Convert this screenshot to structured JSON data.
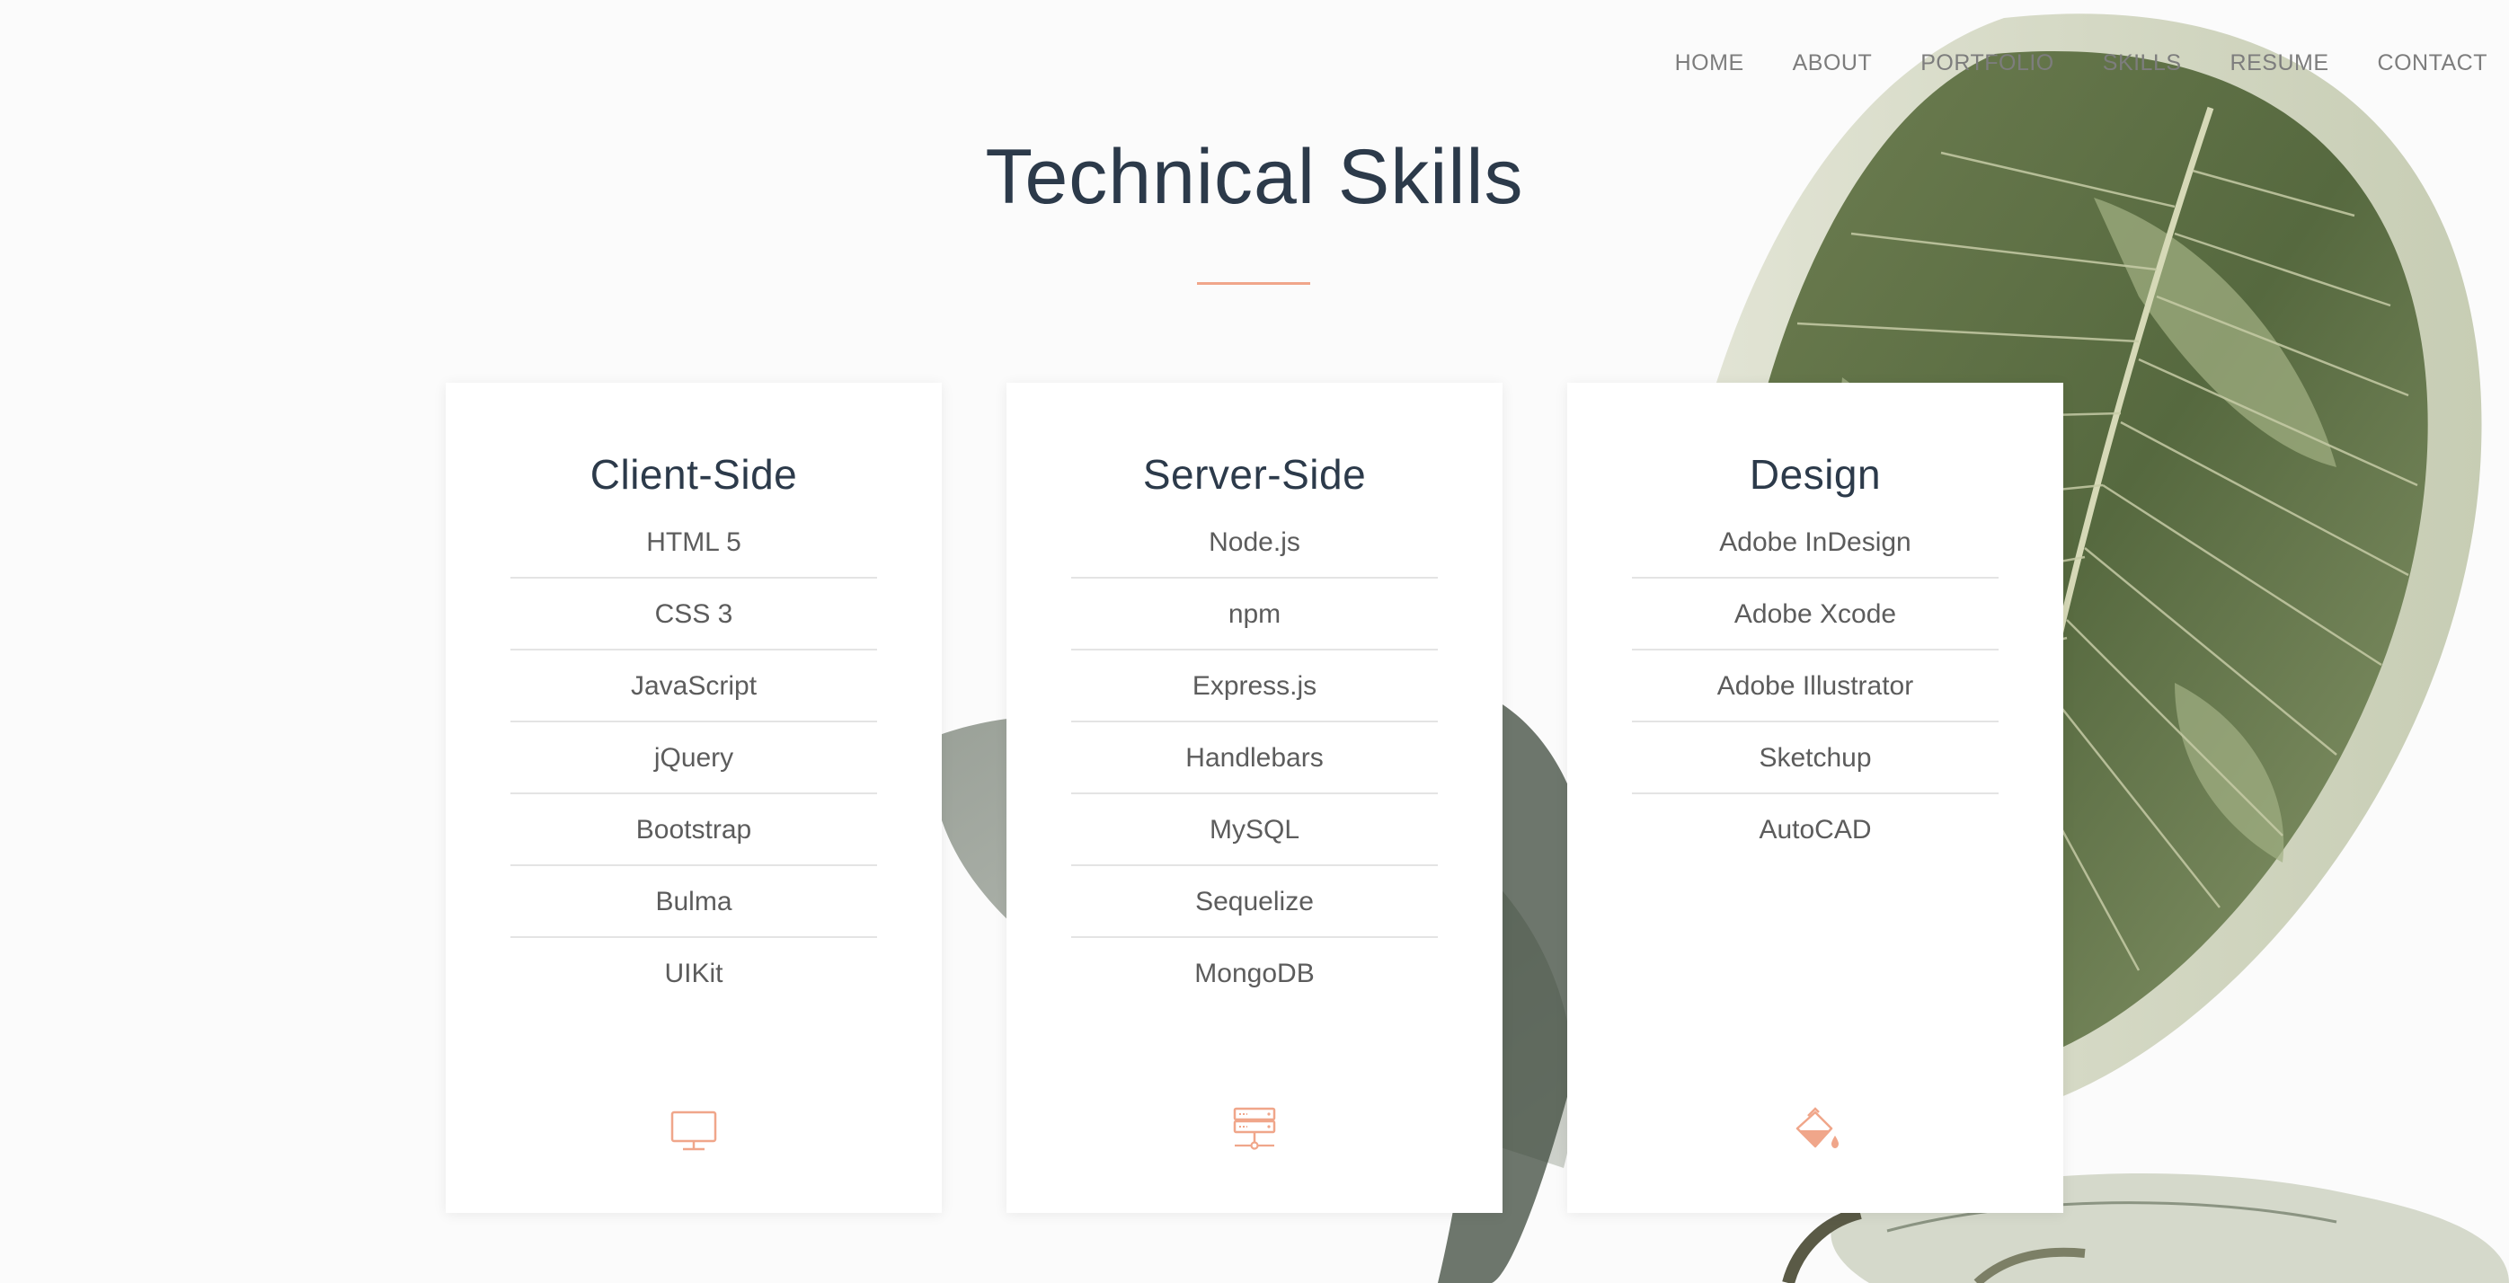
{
  "nav": {
    "items": [
      {
        "label": "HOME"
      },
      {
        "label": "ABOUT"
      },
      {
        "label": "PORTFOLIO"
      },
      {
        "label": "SKILLS"
      },
      {
        "label": "RESUME"
      },
      {
        "label": "CONTACT"
      }
    ]
  },
  "section": {
    "title": "Technical Skills"
  },
  "cards": [
    {
      "title": "Client-Side",
      "icon": "monitor-icon",
      "skills": [
        "HTML 5",
        "CSS 3",
        "JavaScript",
        "jQuery",
        "Bootstrap",
        "Bulma",
        "UIKit"
      ]
    },
    {
      "title": "Server-Side",
      "icon": "server-icon",
      "skills": [
        "Node.js",
        "npm",
        "Express.js",
        "Handlebars",
        "MySQL",
        "Sequelize",
        "MongoDB"
      ]
    },
    {
      "title": "Design",
      "icon": "paint-bucket-icon",
      "skills": [
        "Adobe InDesign",
        "Adobe Xcode",
        "Adobe Illustrator",
        "Sketchup",
        "AutoCAD"
      ]
    }
  ],
  "colors": {
    "accent": "#f0a68a",
    "heading": "#2c3a4a",
    "text": "#5c5c5c",
    "nav": "#7d7d7d",
    "leaf_dark": "#5e7048",
    "leaf_light": "#cfd6bd"
  }
}
